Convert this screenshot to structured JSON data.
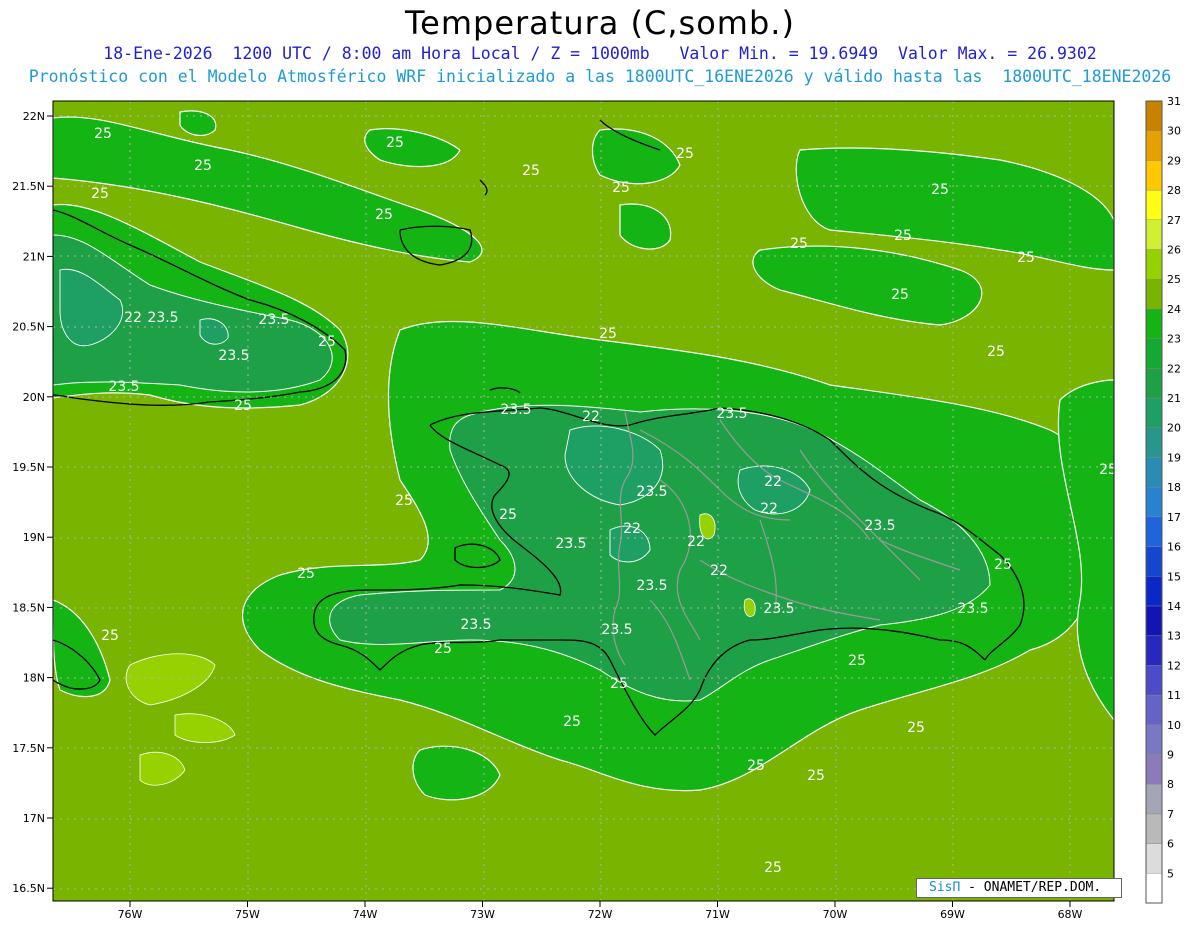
{
  "title": "Temperatura (C,somb.)",
  "subtitle_1": "18-Ene-2026  1200 UTC / 8:00 am Hora Local / Z = 1000mb   Valor Min. = 19.6949  Valor Max. = 26.9302",
  "subtitle_2": "Pronóstico con el Modelo Atmosférico WRF inicializado a las 1800UTC_16ENE2026 y válido hasta las  1800UTC_18ENE2026",
  "credit": {
    "brand": "SisΠ",
    "text": " - ONAMET/REP.DOM."
  },
  "lat_labels": [
    "22N",
    "21.5N",
    "21N",
    "20.5N",
    "20N",
    "19.5N",
    "19N",
    "18.5N",
    "18N",
    "17.5N",
    "17N",
    "16.5N"
  ],
  "lon_labels": [
    "76W",
    "75W",
    "74W",
    "73W",
    "72W",
    "71W",
    "70W",
    "69W",
    "68W"
  ],
  "colorbar": {
    "levels": [
      "5",
      "6",
      "7",
      "8",
      "9",
      "10",
      "11",
      "12",
      "13",
      "14",
      "15",
      "16",
      "17",
      "18",
      "19",
      "20",
      "21",
      "22",
      "23",
      "24",
      "25",
      "26",
      "27",
      "28",
      "29",
      "30",
      "31"
    ],
    "colors": [
      "#ffffff",
      "#dcdcdc",
      "#b9b9b9",
      "#a5a5b8",
      "#8c7ab9",
      "#7878c3",
      "#6464c8",
      "#4c4cc8",
      "#2828be",
      "#1414b4",
      "#0a28c8",
      "#1446d2",
      "#1e64dc",
      "#2882d2",
      "#2a8cb4",
      "#28968c",
      "#1ea064",
      "#1ea046",
      "#14aa32",
      "#14b414",
      "#78b400",
      "#96d200",
      "#d2f032",
      "#ffff14",
      "#ffc800",
      "#e6a000",
      "#c88200"
    ]
  },
  "contour_labels": [
    "25",
    "25",
    "25",
    "25",
    "25",
    "25",
    "25",
    "25",
    "25",
    "25",
    "25",
    "25",
    "25",
    "25",
    "25",
    "25",
    "25",
    "25",
    "25",
    "25",
    "25",
    "25",
    "25",
    "25",
    "25",
    "25",
    "25",
    "25",
    "25",
    "25",
    "25",
    "23.5",
    "23.5",
    "23.5",
    "23.5",
    "23.5",
    "23.5",
    "23.5",
    "23.5",
    "23.5",
    "23.5",
    "23.5",
    "23.5",
    "23.5",
    "23.5",
    "22",
    "22",
    "22",
    "22",
    "22",
    "22",
    "22"
  ],
  "colors": {
    "field_25": "#78b400",
    "field_24": "#14b414",
    "field_23": "#14aa32",
    "field_22": "#1ea046",
    "field_21": "#1ea064",
    "field_26": "#96d200",
    "coast": "#000000",
    "borders": "#9a9a9a"
  }
}
